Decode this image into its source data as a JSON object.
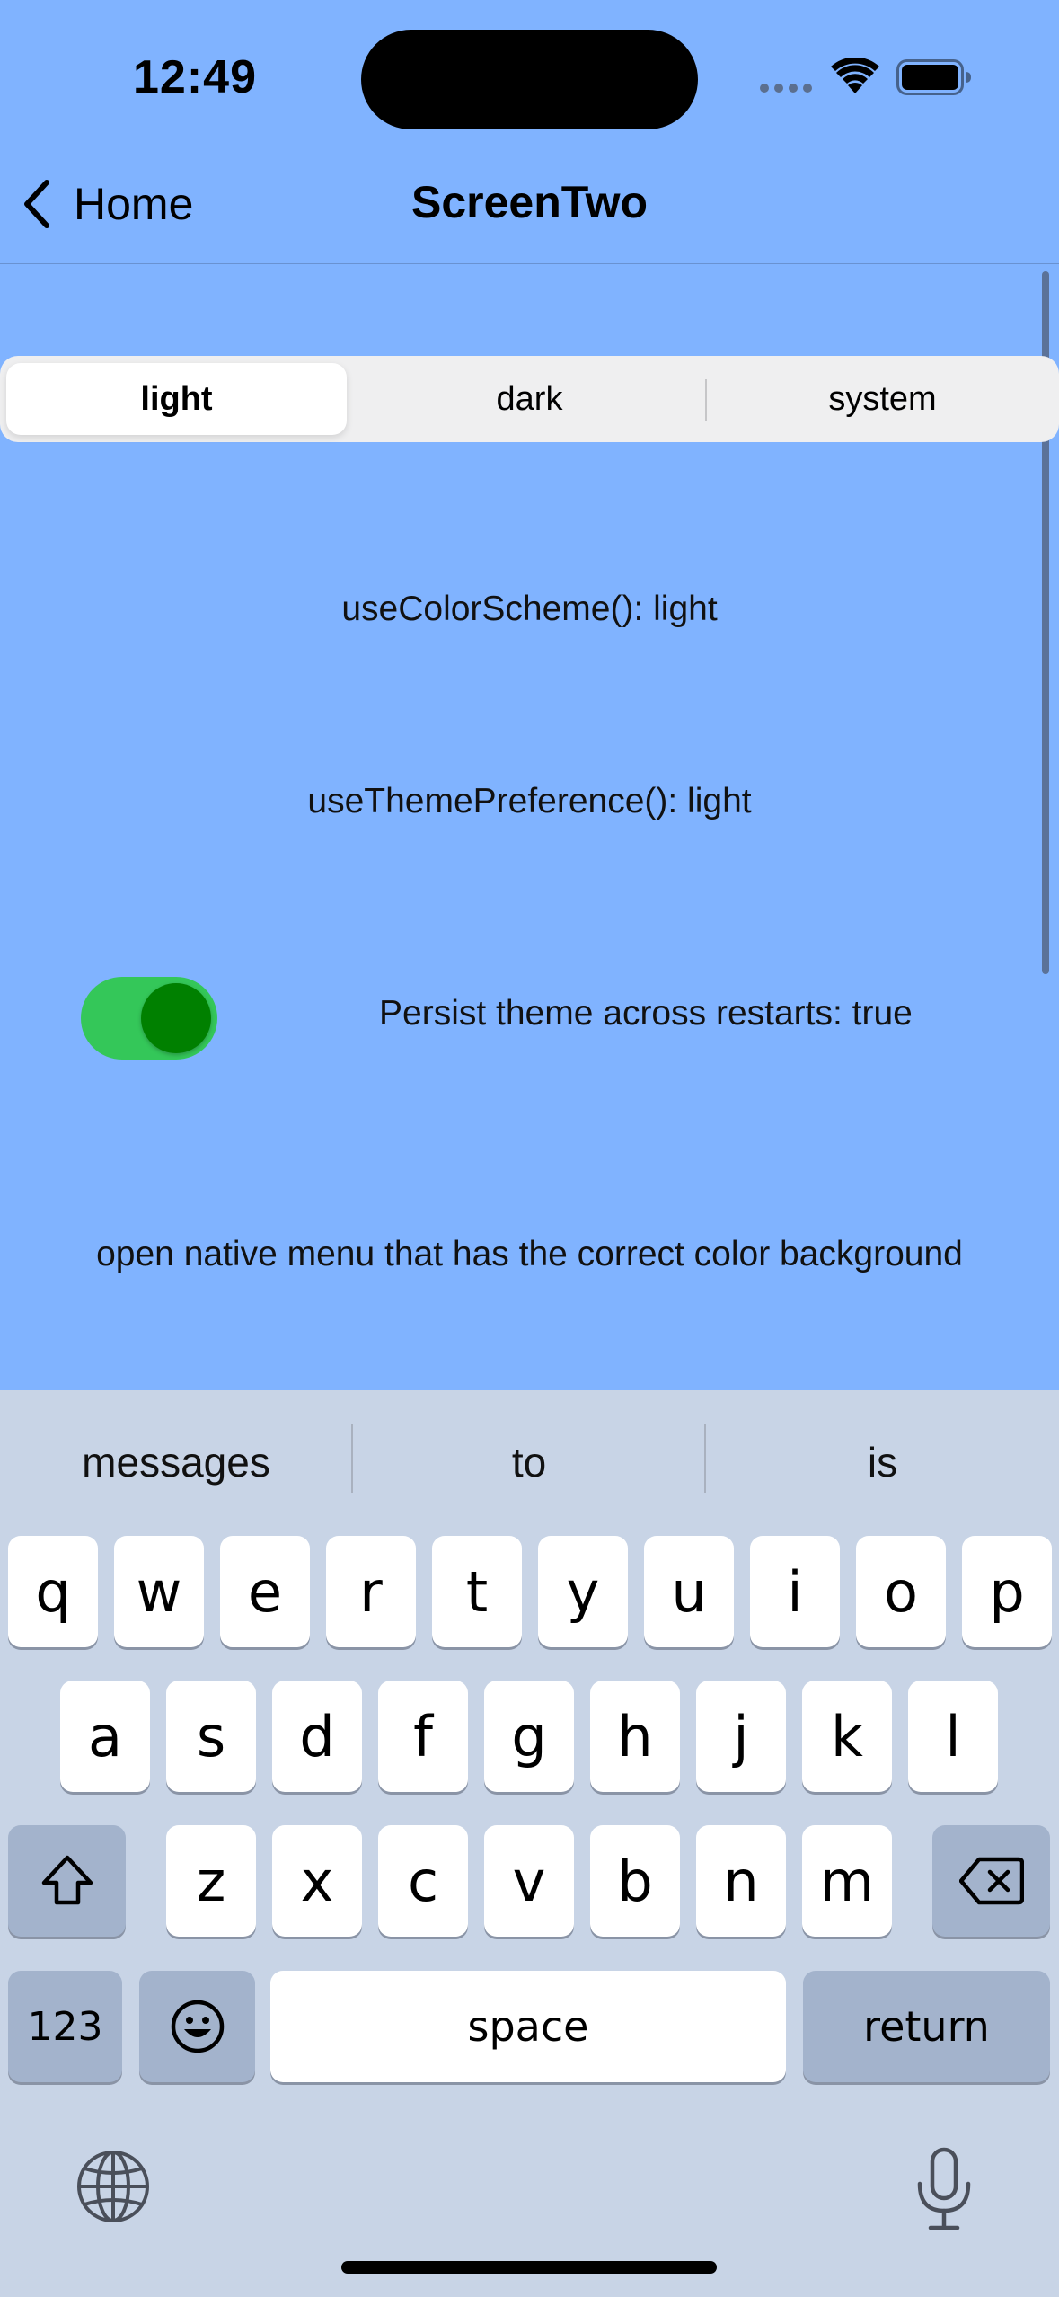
{
  "status_bar": {
    "time": "12:49",
    "icons": [
      "signal-dots-icon",
      "wifi-icon",
      "battery-icon"
    ]
  },
  "nav": {
    "back_label": "Home",
    "title": "ScreenTwo"
  },
  "segmented": {
    "options": [
      "light",
      "dark",
      "system"
    ],
    "selected": "light"
  },
  "main": {
    "color_scheme_text": "useColorScheme(): light",
    "theme_pref_text": "useThemePreference(): light",
    "persist_label": "Persist theme across restarts: true",
    "persist_toggle_on": true,
    "menu_text": "open native menu that has the correct color background"
  },
  "keyboard": {
    "suggestions": [
      "messages",
      "to",
      "is"
    ],
    "row1": [
      "q",
      "w",
      "e",
      "r",
      "t",
      "y",
      "u",
      "i",
      "o",
      "p"
    ],
    "row2": [
      "a",
      "s",
      "d",
      "f",
      "g",
      "h",
      "j",
      "k",
      "l"
    ],
    "row3": [
      "z",
      "x",
      "c",
      "v",
      "b",
      "n",
      "m"
    ],
    "numbers_label": "123",
    "space_label": "space",
    "return_label": "return"
  },
  "colors": {
    "background": "#80b3ff",
    "toggle_track": "#34c759",
    "toggle_knob": "#008000",
    "keyboard_bg": "#c8d4e6"
  }
}
